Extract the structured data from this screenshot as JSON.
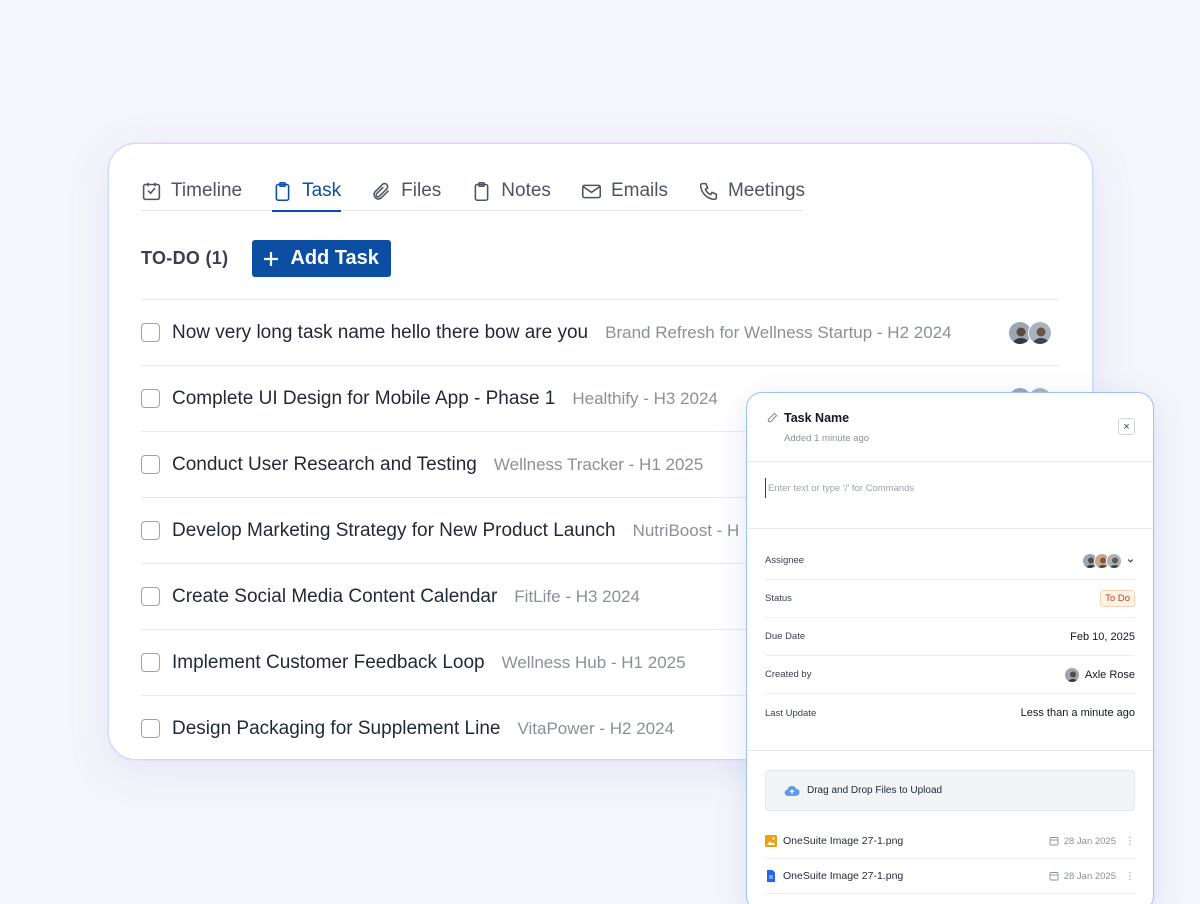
{
  "tabs": [
    {
      "label": "Timeline",
      "icon": "timeline-icon"
    },
    {
      "label": "Task",
      "icon": "clipboard-icon",
      "active": true
    },
    {
      "label": "Files",
      "icon": "paperclip-icon"
    },
    {
      "label": "Notes",
      "icon": "notes-icon"
    },
    {
      "label": "Emails",
      "icon": "mail-icon"
    },
    {
      "label": "Meetings",
      "icon": "phone-icon"
    }
  ],
  "todo": {
    "label": "TO-DO (1)",
    "add_task_label": "Add Task"
  },
  "tasks": [
    {
      "name": "Now very long task name hello there bow are you",
      "project": "Brand Refresh for Wellness Startup - H2 2024"
    },
    {
      "name": "Complete UI Design for Mobile App - Phase 1",
      "project": "Healthify - H3 2024"
    },
    {
      "name": "Conduct User Research and Testing",
      "project": "Wellness Tracker - H1 2025"
    },
    {
      "name": "Develop Marketing Strategy for New Product Launch",
      "project": "NutriBoost - H"
    },
    {
      "name": "Create Social Media Content Calendar",
      "project": "FitLife - H3 2024"
    },
    {
      "name": "Implement Customer Feedback Loop",
      "project": "Wellness Hub - H1 2025"
    },
    {
      "name": "Design Packaging for Supplement Line",
      "project": "VitaPower - H2 2024"
    }
  ],
  "panel": {
    "title": "Task Name",
    "subtitle": "Added 1 minute ago",
    "close": "×",
    "editor_placeholder": "Enter text or type '/' for Commands",
    "props": {
      "assignee_label": "Assignee",
      "status_label": "Status",
      "status_value": "To Do",
      "due_label": "Due Date",
      "due_value": "Feb 10, 2025",
      "created_label": "Created by",
      "created_value": "Axle Rose",
      "update_label": "Last Update",
      "update_value": "Less than a minute ago"
    },
    "upload_label": "Drag and Drop Files to Upload",
    "files": [
      {
        "name": "OneSuite Image 27-1.png",
        "date": "28 Jan 2025",
        "icon": "image-file-icon"
      },
      {
        "name": "OneSuite Image 27-1.png",
        "date": "28 Jan 2025",
        "icon": "doc-file-icon"
      }
    ]
  },
  "colors": {
    "accent": "#0b4ea2",
    "status_text": "#b4471b",
    "status_bg": "#fdf2e8"
  }
}
